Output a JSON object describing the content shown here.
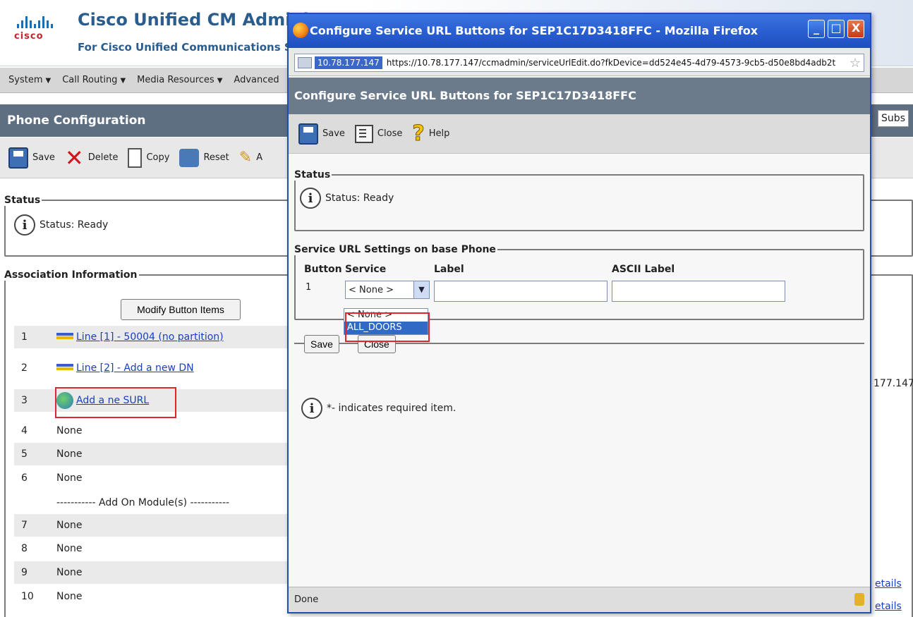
{
  "background": {
    "brand": {
      "logo_text": "cisco",
      "title": "Cisco Unified CM Adminis",
      "subtitle": "For Cisco Unified Communications Se"
    },
    "menu": [
      "System",
      "Call Routing",
      "Media Resources",
      "Advanced"
    ],
    "page_title": "Phone Configuration",
    "subs_label": "Subs",
    "toolbar": {
      "save": "Save",
      "delete": "Delete",
      "copy": "Copy",
      "reset": "Reset",
      "apply_partial": "A"
    },
    "status": {
      "legend": "Status",
      "text": "Status: Ready"
    },
    "association": {
      "legend": "Association Information",
      "modify_button": "Modify Button Items",
      "rows": [
        {
          "num": "1",
          "value": "Line [1] - 50004 (no partition)",
          "kind": "line"
        },
        {
          "num": "2",
          "value": "Line [2] - Add a new DN",
          "kind": "line"
        },
        {
          "num": "3",
          "value": "Add a ne  SURL",
          "kind": "surl"
        },
        {
          "num": "4",
          "value": "None",
          "kind": "text"
        },
        {
          "num": "5",
          "value": "None",
          "kind": "text"
        },
        {
          "num": "6",
          "value": "None",
          "kind": "text"
        },
        {
          "num": "7",
          "value": "None",
          "kind": "text"
        },
        {
          "num": "8",
          "value": "None",
          "kind": "text"
        },
        {
          "num": "9",
          "value": "None",
          "kind": "text"
        },
        {
          "num": "10",
          "value": "None",
          "kind": "text"
        }
      ],
      "addon_label": "----------- Add On Module(s) -----------"
    },
    "right_edge": {
      "ip_fragment": "177.147",
      "details_1": "etails",
      "details_2": "etails"
    }
  },
  "popup": {
    "window_title": "Configure Service URL Buttons for SEP1C17D3418FFC - Mozilla Firefox",
    "window_controls": [
      "_",
      "□",
      "X"
    ],
    "address": {
      "host": "10.78.177.147",
      "url": "https://10.78.177.147/ccmadmin/serviceUrlEdit.do?fkDevice=dd524e45-4d79-4573-9cb5-d50e8bd4adb2t"
    },
    "header": "Configure Service URL Buttons for SEP1C17D3418FFC",
    "toolbar": {
      "save": "Save",
      "close": "Close",
      "help": "Help"
    },
    "status": {
      "legend": "Status",
      "text": "Status: Ready"
    },
    "service_settings": {
      "legend": "Service URL Settings on base Phone",
      "columns": {
        "button": "Button",
        "service": "Service",
        "label": "Label",
        "ascii_label": "ASCII Label"
      },
      "row": {
        "button": "1",
        "service_selected": "< None >",
        "label": "",
        "ascii_label": ""
      },
      "dropdown_options": [
        "< None >",
        "ALL_DOORS"
      ]
    },
    "buttons": {
      "save": "Save",
      "close": "Close"
    },
    "required_note": "*- indicates required item.",
    "statusbar": "Done"
  }
}
